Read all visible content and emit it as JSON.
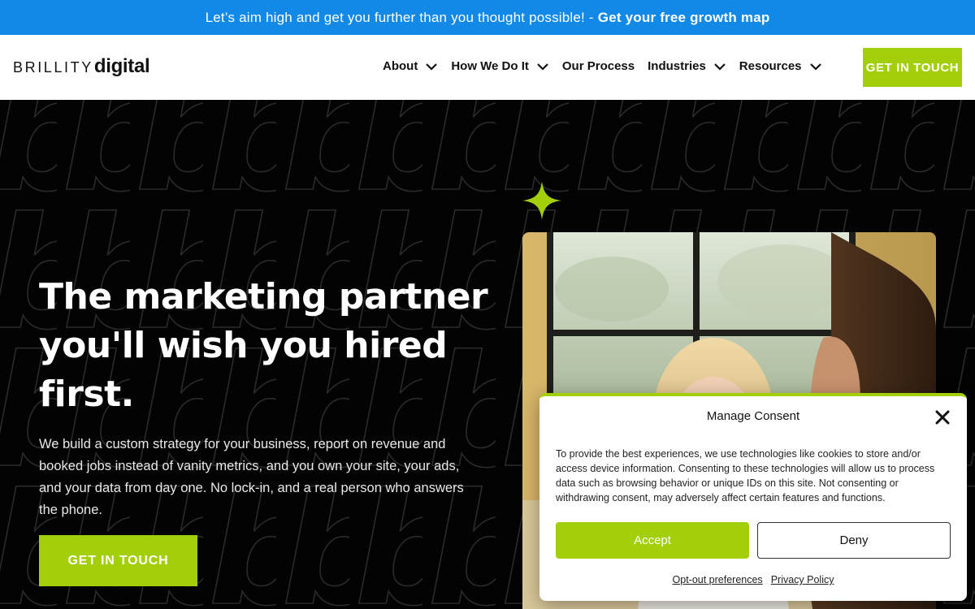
{
  "announcement": {
    "text": "Let’s aim high and get you further than you thought possible! -",
    "link_label": "Get your free growth map"
  },
  "logo": {
    "part1": "BRILLITY",
    "part2": "digital"
  },
  "nav": {
    "items": [
      {
        "label": "About",
        "has_dropdown": true
      },
      {
        "label": "How We Do It",
        "has_dropdown": true
      },
      {
        "label": "Our Process",
        "has_dropdown": false
      },
      {
        "label": "Industries",
        "has_dropdown": true
      },
      {
        "label": "Resources",
        "has_dropdown": true
      }
    ],
    "cta_label": "GET IN TOUCH"
  },
  "hero": {
    "headline": "The marketing partner you'll wish you hired first.",
    "description": "We build a custom strategy for your business, report on revenue and booked jobs instead of vanity metrics, and you own your site, your ads, and your data from day one. No lock-in, and a real person who answers the phone.",
    "cta_label": "GET IN TOUCH"
  },
  "consent": {
    "title": "Manage Consent",
    "body": "To provide the best experiences, we use technologies like cookies to store and/or access device information. Consenting to these technologies will allow us to process data such as browsing behavior or unique IDs on this site. Not consenting or withdrawing consent, may adversely affect certain features and functions.",
    "accept_label": "Accept",
    "deny_label": "Deny",
    "optout_label": "Opt-out preferences",
    "privacy_label": "Privacy Policy"
  },
  "colors": {
    "brand_green": "#a2cf0a",
    "topbar_blue": "#1289e6",
    "hero_bg": "#030303"
  },
  "icons": [
    "chevron-down-icon",
    "sparkle-icon",
    "close-icon"
  ]
}
